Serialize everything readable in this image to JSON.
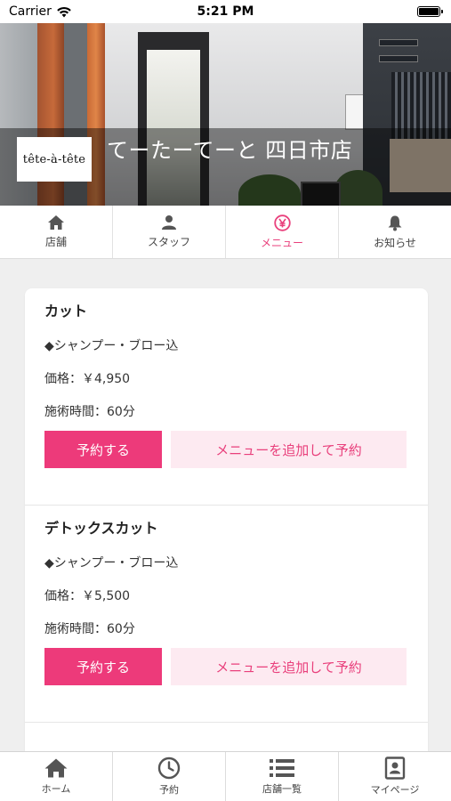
{
  "status_bar": {
    "carrier": "Carrier",
    "time": "5:21 PM"
  },
  "header": {
    "logo_text": "tête-à-tête",
    "shop_name": "てーたーてーと 四日市店"
  },
  "top_tabs": [
    {
      "label": "店舗",
      "icon": "home-icon",
      "active": false
    },
    {
      "label": "スタッフ",
      "icon": "person-icon",
      "active": false
    },
    {
      "label": "メニュー",
      "icon": "yen-icon",
      "active": true
    },
    {
      "label": "お知らせ",
      "icon": "bell-icon",
      "active": false
    }
  ],
  "menu_items": [
    {
      "title": "カット",
      "description": "◆シャンプー・ブロー込",
      "price": "価格：￥4,950",
      "duration": "施術時間：60分",
      "reserve_label": "予約する",
      "add_label": "メニューを追加して予約"
    },
    {
      "title": "デトックスカット",
      "description": "◆シャンプー・ブロー込",
      "price": "価格：￥5,500",
      "duration": "施術時間：60分",
      "reserve_label": "予約する",
      "add_label": "メニューを追加して予約"
    }
  ],
  "bottom_tabs": [
    {
      "label": "ホーム",
      "icon": "home-icon"
    },
    {
      "label": "予約",
      "icon": "clock-icon"
    },
    {
      "label": "店舗一覧",
      "icon": "list-icon"
    },
    {
      "label": "マイページ",
      "icon": "profile-card-icon"
    }
  ],
  "colors": {
    "accent": "#ed3a7a",
    "accent_light": "#fdeaf1",
    "background": "#efefef"
  }
}
